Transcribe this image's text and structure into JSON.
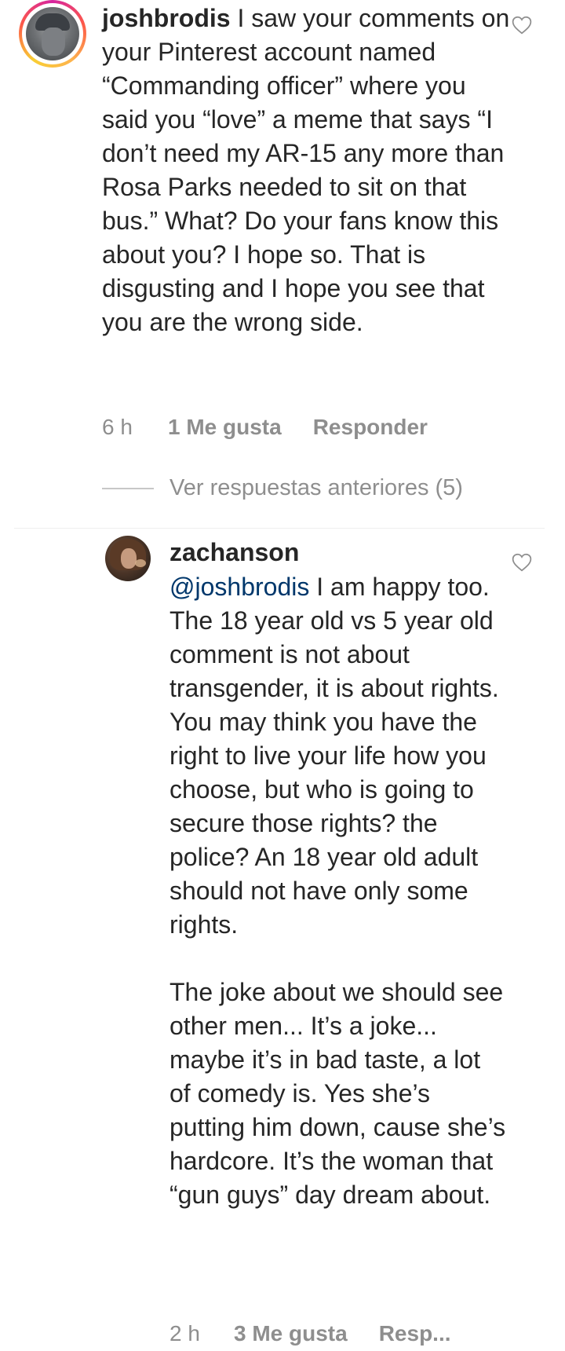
{
  "comment_main": {
    "username": "joshbrodis",
    "text": " I saw your comments on your Pinterest account named “Commanding officer” where you said you “love” a meme that says “I don’t need my AR-15 any more than Rosa Parks needed to sit on that bus.” What? Do your fans know this about you? I hope so. That is disgusting and I hope you see that you are the wrong side.",
    "time": "6 h",
    "likes": "1 Me gusta",
    "reply_label": "Responder",
    "view_previous_replies": "Ver respuestas anteriores (5)"
  },
  "reply": {
    "username": "zachanson",
    "mention": "@joshbrodis",
    "paragraph_1": " I am happy too. The 18 year old vs 5 year old comment is not about transgender, it is about rights. You may think you have the right to live your life how you choose, but who is going to secure those rights? the police? An 18 year old adult should not have only some rights.",
    "paragraph_2": "The joke about we should see other men... It’s a joke... maybe it’s in bad taste, a lot of comedy is. Yes she’s putting him down, cause she’s hardcore. It’s the woman that “gun guys” day dream about.",
    "time": "2 h",
    "likes": "3 Me gusta",
    "reply_label": "Resp..."
  },
  "icons": {
    "like": "heart-outline-icon",
    "avatar_ring": "story-ring"
  },
  "colors": {
    "text": "#262626",
    "secondary": "#8e8e8e",
    "mention": "#00376b",
    "divider": "#efefef"
  }
}
